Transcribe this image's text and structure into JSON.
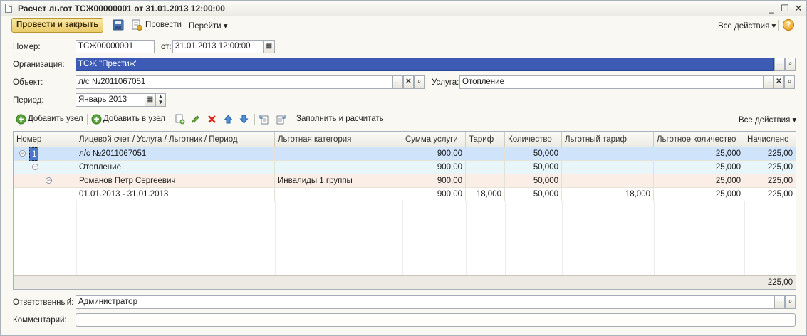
{
  "window": {
    "title": "Расчет льгот ТСЖ00000001 от 31.01.2013 12:00:00",
    "minimize": "_",
    "maximize": "☐",
    "close": "✕"
  },
  "toolbar": {
    "post_close": "Провести и закрыть",
    "post": "Провести",
    "goto": "Перейти",
    "all_actions": "Все действия",
    "help": "?"
  },
  "form": {
    "number_label": "Номер:",
    "number": "ТСЖ00000001",
    "from_label": "от:",
    "date": "31.01.2013 12:00:00",
    "org_label": "Организация:",
    "org": "ТСЖ \"Престиж\"",
    "object_label": "Объект:",
    "object": "л/с №2011067051",
    "service_label": "Услуга:",
    "service": "Отопление",
    "period_label": "Период:",
    "period": "Январь 2013",
    "responsible_label": "Ответственный:",
    "responsible": "Администратор",
    "comment_label": "Комментарий:",
    "comment": ""
  },
  "table_toolbar": {
    "add_node": "Добавить узел",
    "add_in_node": "Добавить в узел",
    "fill_calc": "Заполнить и расчитать",
    "all_actions": "Все действия"
  },
  "table": {
    "columns": [
      "Номер",
      "Лицевой счет / Услуга / Льготник / Период",
      "Льготная категория",
      "Сумма услуги",
      "Тариф",
      "Количество",
      "Льготный тариф",
      "Льготное количество",
      "Начислено"
    ],
    "rows": [
      {
        "num": "1",
        "name": "л/с №2011067051",
        "cat": "",
        "sum": "900,00",
        "tariff": "",
        "qty": "50,000",
        "ltariff": "",
        "lqty": "25,000",
        "acc": "225,00"
      },
      {
        "num": "",
        "name": "Отопление",
        "cat": "",
        "sum": "900,00",
        "tariff": "",
        "qty": "50,000",
        "ltariff": "",
        "lqty": "25,000",
        "acc": "225,00"
      },
      {
        "num": "",
        "name": "Романов Петр Сергеевич",
        "cat": "Инвалиды 1 группы",
        "sum": "900,00",
        "tariff": "",
        "qty": "50,000",
        "ltariff": "",
        "lqty": "25,000",
        "acc": "225,00"
      },
      {
        "num": "",
        "name": "01.01.2013 - 31.01.2013",
        "cat": "",
        "sum": "900,00",
        "tariff": "18,000",
        "qty": "50,000",
        "ltariff": "18,000",
        "lqty": "25,000",
        "acc": "225,00"
      }
    ],
    "total": "225,00"
  },
  "colors": {
    "accent_button": "#eacb6a",
    "selected_row": "#cfe3fb",
    "selected_field": "#3d5bb5"
  }
}
